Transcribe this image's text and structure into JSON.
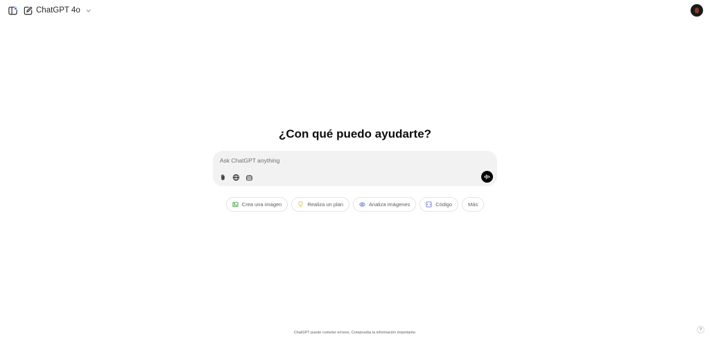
{
  "header": {
    "model_name": "ChatGPT 4o",
    "sidebar_icon": "sidebar-icon",
    "new_chat_icon": "edit-icon",
    "notification_dot_color": "#2f7ef7"
  },
  "main": {
    "headline": "¿Con qué puedo ayudarte?",
    "composer": {
      "placeholder": "Ask ChatGPT anything",
      "tools": [
        "paperclip-icon",
        "globe-icon",
        "toolbox-icon"
      ],
      "voice_icon": "voice-wave-icon"
    },
    "suggestions": [
      {
        "label": "Crea una imagen",
        "icon": "image-icon",
        "color": "#4caf50"
      },
      {
        "label": "Realiza un plan",
        "icon": "lightbulb-icon",
        "color": "#e2c541"
      },
      {
        "label": "Analiza imágenes",
        "icon": "eye-icon",
        "color": "#5b7fd6"
      },
      {
        "label": "Código",
        "icon": "code-icon",
        "color": "#6b7ad9"
      },
      {
        "label": "Más",
        "icon": "",
        "color": ""
      }
    ]
  },
  "footer": {
    "disclaimer": "ChatGPT puede cometer errores. Comprueba la información importante.",
    "help_label": "?"
  }
}
